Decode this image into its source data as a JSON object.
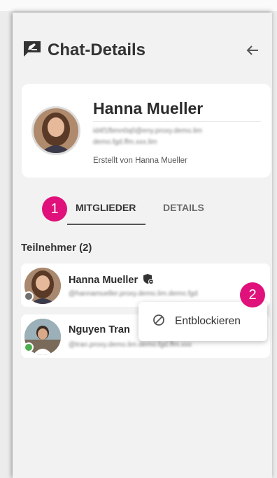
{
  "header": {
    "title": "Chat-Details"
  },
  "profile": {
    "name": "Hanna Mueller",
    "email_blurred": "id4f1fbmn0q0@eny.proxy.demo.lim demo.fgd.ffm.xxx.lim",
    "created_by": "Erstellt von Hanna Mueller"
  },
  "tabs": [
    {
      "label": "MITGLIEDER",
      "active": true
    },
    {
      "label": "DETAILS",
      "active": false
    }
  ],
  "markers": {
    "one": "1",
    "two": "2"
  },
  "participants": {
    "title": "Teilnehmer (2)",
    "items": [
      {
        "name": "Hanna Mueller",
        "email_blurred": "@hannamueller.proxy.demo.lim.demo.fgd",
        "status": "offline",
        "status_color": "#6f6f6f",
        "blocked": true
      },
      {
        "name": "Nguyen Tran",
        "email_blurred": "@tran.proxy.demo.lim.demo.fgd.ffm.xxx",
        "status": "online",
        "status_color": "#4caf50",
        "blocked": false
      }
    ]
  },
  "context_menu": {
    "item_label": "Entblockieren",
    "item_icon": "block-icon"
  },
  "colors": {
    "marker": "#e0117a"
  }
}
